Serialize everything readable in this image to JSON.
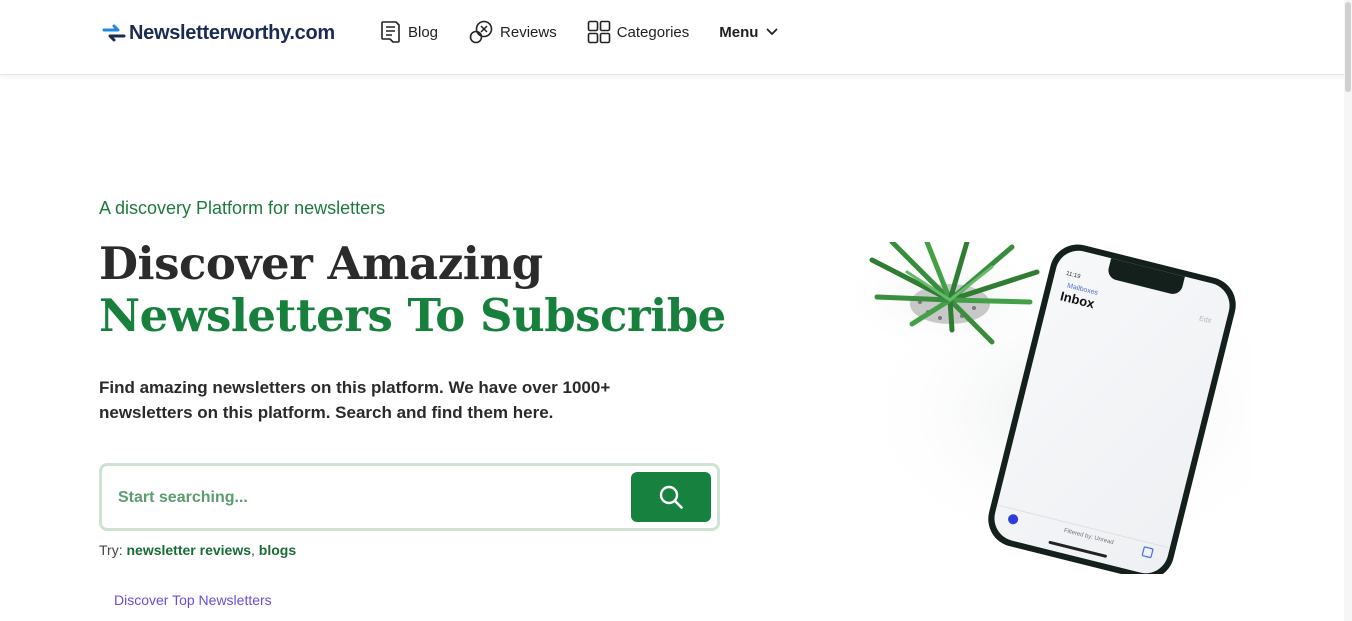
{
  "header": {
    "logo_text": "Newsletterworthy.com",
    "nav": [
      {
        "label": "Blog",
        "icon": "document-icon"
      },
      {
        "label": "Reviews",
        "icon": "review-icon"
      },
      {
        "label": "Categories",
        "icon": "grid-icon"
      },
      {
        "label": "Menu",
        "icon": "chevron-down-icon"
      }
    ]
  },
  "hero": {
    "tagline": "A discovery Platform for newsletters",
    "title_line1": "Discover Amazing",
    "title_line2": "Newsletters To Subscribe",
    "description": "Find amazing newsletters on this platform. We have over 1000+ newsletters on this platform. Search and find them here.",
    "search": {
      "placeholder": "Start searching...",
      "value": "",
      "button_icon": "search-icon"
    },
    "try": {
      "prefix": "Try:",
      "links": [
        "newsletter reviews",
        "blogs"
      ],
      "separator": ","
    },
    "discover_link": "Discover Top Newsletters"
  },
  "phone": {
    "back_label": "Mailboxes",
    "title": "Inbox",
    "edit_label": "Edit",
    "footer_text": "Filtered by: Unread"
  },
  "colors": {
    "brand_navy": "#1a2b55",
    "brand_blue": "#1e88e5",
    "accent_green": "#17823f",
    "link_purple": "#6a4cd8"
  }
}
